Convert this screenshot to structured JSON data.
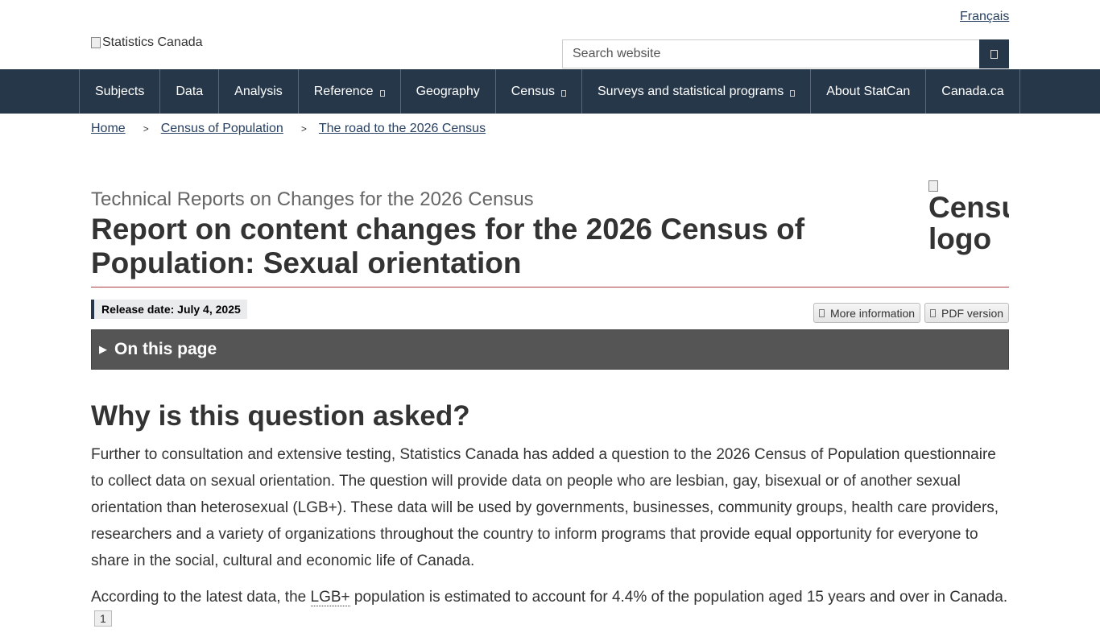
{
  "header": {
    "language_link": "Français",
    "logo_alt": "Statistics Canada",
    "search_placeholder": "Search website",
    "search_button_icon": "search-icon"
  },
  "nav": {
    "items": [
      {
        "label": "Subjects"
      },
      {
        "label": "Data"
      },
      {
        "label": "Analysis"
      },
      {
        "label": "Reference",
        "dropdown": true
      },
      {
        "label": "Geography"
      },
      {
        "label": "Census",
        "dropdown": true
      },
      {
        "label": "Surveys and statistical programs",
        "dropdown": true
      },
      {
        "label": "About StatCan"
      },
      {
        "label": "Canada.ca"
      }
    ]
  },
  "breadcrumb": {
    "separator": ">",
    "items": [
      "Home",
      "Census of Population",
      "The road to the 2026 Census"
    ]
  },
  "page": {
    "kicker": "Technical Reports on Changes for the 2026 Census",
    "title": "Report on content changes for the 2026 Census of Population: Sexual orientation",
    "census_logo_alt": "Census logo",
    "release_date": "Release date: July 4, 2025",
    "more_info_label": "More information",
    "pdf_label": "PDF version",
    "on_this_page_label": "On this page"
  },
  "content": {
    "heading": "Why is this question asked?",
    "paragraph1": "Further to consultation and extensive testing, Statistics Canada has added a question to the 2026 Census of Population questionnaire to collect data on sexual orientation. The question will provide data on people who are lesbian, gay, bisexual or of another sexual orientation than heterosexual (LGB+). These data will be used by governments, businesses, community groups, health care providers, researchers and a variety of organizations throughout the country to inform programs that provide equal opportunity for everyone to share in the social, cultural and economic life of Canada.",
    "paragraph2_before": "According to the latest data, the ",
    "paragraph2_abbr": "LGB+",
    "paragraph2_after": " population is estimated to account for 4.4% of the population aged 15 years and over in Canada.",
    "footnote": "1"
  },
  "colors": {
    "nav_bg": "#26374a",
    "link": "#284162",
    "title_rule": "#af3c43",
    "on_this_page_bg": "#555555"
  }
}
